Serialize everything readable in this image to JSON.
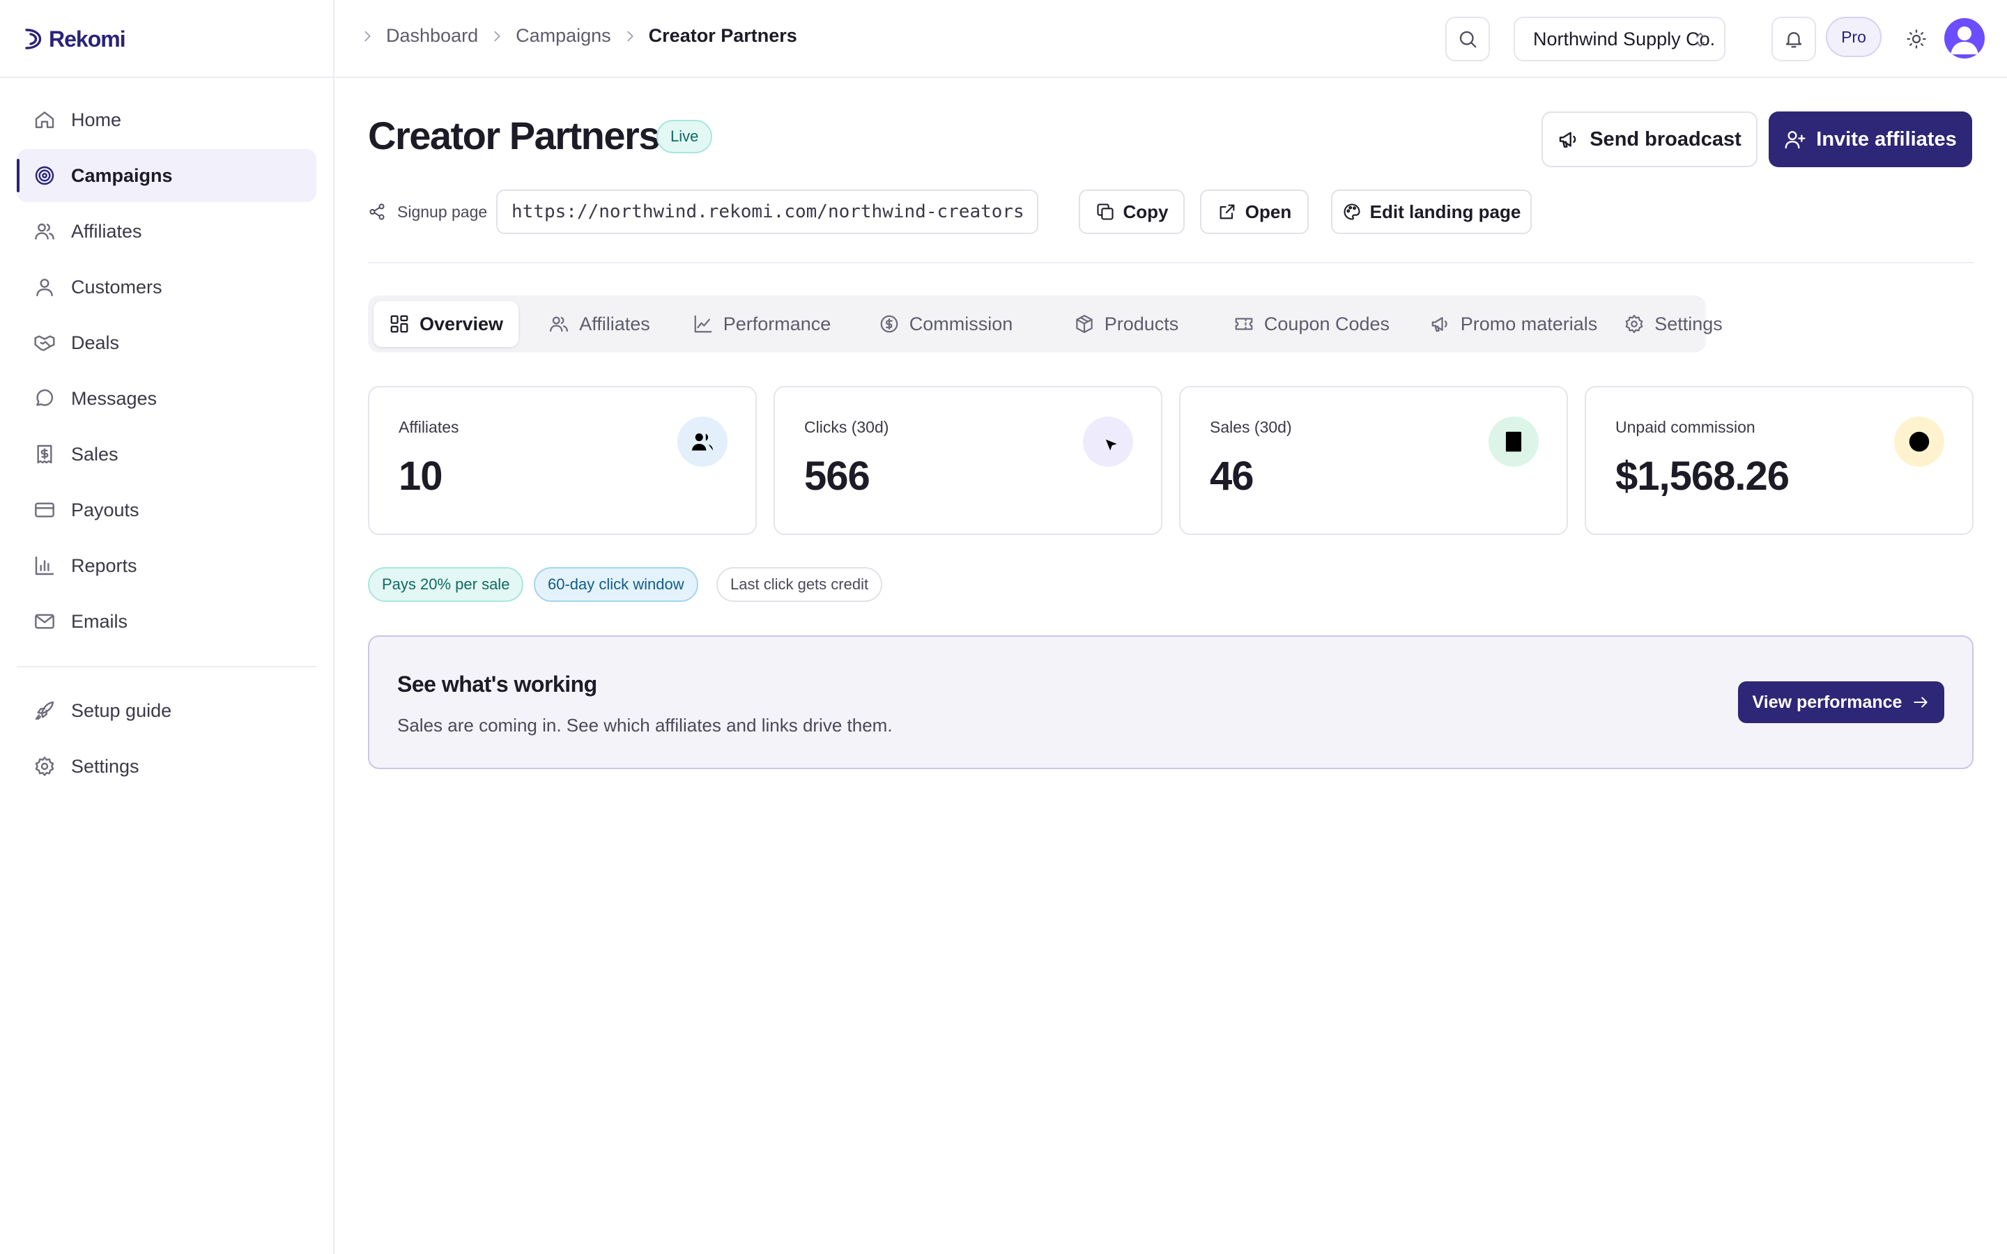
{
  "app": {
    "name": "Rekomi"
  },
  "sidebar": {
    "items": [
      {
        "label": "Home",
        "icon": "home-icon"
      },
      {
        "label": "Campaigns",
        "icon": "target-icon",
        "active": true
      },
      {
        "label": "Affiliates",
        "icon": "users-icon"
      },
      {
        "label": "Customers",
        "icon": "user-icon"
      },
      {
        "label": "Deals",
        "icon": "handshake-icon"
      },
      {
        "label": "Messages",
        "icon": "message-icon"
      },
      {
        "label": "Sales",
        "icon": "receipt-icon"
      },
      {
        "label": "Payouts",
        "icon": "credit-card-icon"
      },
      {
        "label": "Reports",
        "icon": "bar-chart-icon"
      },
      {
        "label": "Emails",
        "icon": "mail-icon"
      }
    ],
    "secondary": [
      {
        "label": "Setup guide",
        "icon": "rocket-icon"
      },
      {
        "label": "Settings",
        "icon": "gear-icon"
      }
    ]
  },
  "topbar": {
    "breadcrumb": [
      "Dashboard",
      "Campaigns",
      "Creator Partners"
    ],
    "org": "Northwind Supply Co.",
    "plan": "Pro"
  },
  "campaign": {
    "title": "Creator Partners",
    "status": "Live",
    "actions": {
      "broadcast": "Send broadcast",
      "invite": "Invite affiliates"
    },
    "signup": {
      "label": "Signup page",
      "url": "https://northwind.rekomi.com/northwind-creators",
      "copy": "Copy",
      "open": "Open",
      "edit": "Edit landing page"
    }
  },
  "tabs": [
    {
      "label": "Overview",
      "icon": "grid-icon",
      "active": true
    },
    {
      "label": "Affiliates",
      "icon": "users-icon"
    },
    {
      "label": "Performance",
      "icon": "line-chart-icon"
    },
    {
      "label": "Commission",
      "icon": "dollar-icon"
    },
    {
      "label": "Products",
      "icon": "box-icon"
    },
    {
      "label": "Coupon Codes",
      "icon": "ticket-icon"
    },
    {
      "label": "Promo materials",
      "icon": "megaphone-icon"
    },
    {
      "label": "Settings",
      "icon": "gear-icon"
    }
  ],
  "stats": [
    {
      "label": "Affiliates",
      "value": "10",
      "icon": "users-icon",
      "color": "#2f7fd0",
      "bg": "#e3f0fb"
    },
    {
      "label": "Clicks (30d)",
      "value": "566",
      "icon": "cursor-click-icon",
      "color": "#6b4eff",
      "bg": "#eeebfd"
    },
    {
      "label": "Sales (30d)",
      "value": "46",
      "icon": "receipt-icon",
      "color": "#119a5b",
      "bg": "#dcf5e8"
    },
    {
      "label": "Unpaid commission",
      "value": "$1,568.26",
      "icon": "clock-icon",
      "color": "#e0a000",
      "bg": "#fff3cf"
    }
  ],
  "pills": [
    "Pays 20% per sale",
    "60-day click window",
    "Last click gets credit"
  ],
  "insight": {
    "title": "See what's working",
    "text": "Sales are coming in. See which affiliates and links drive them.",
    "button": "View performance"
  },
  "colors": {
    "accent": "#2e2676",
    "live": "#0f6a60"
  }
}
